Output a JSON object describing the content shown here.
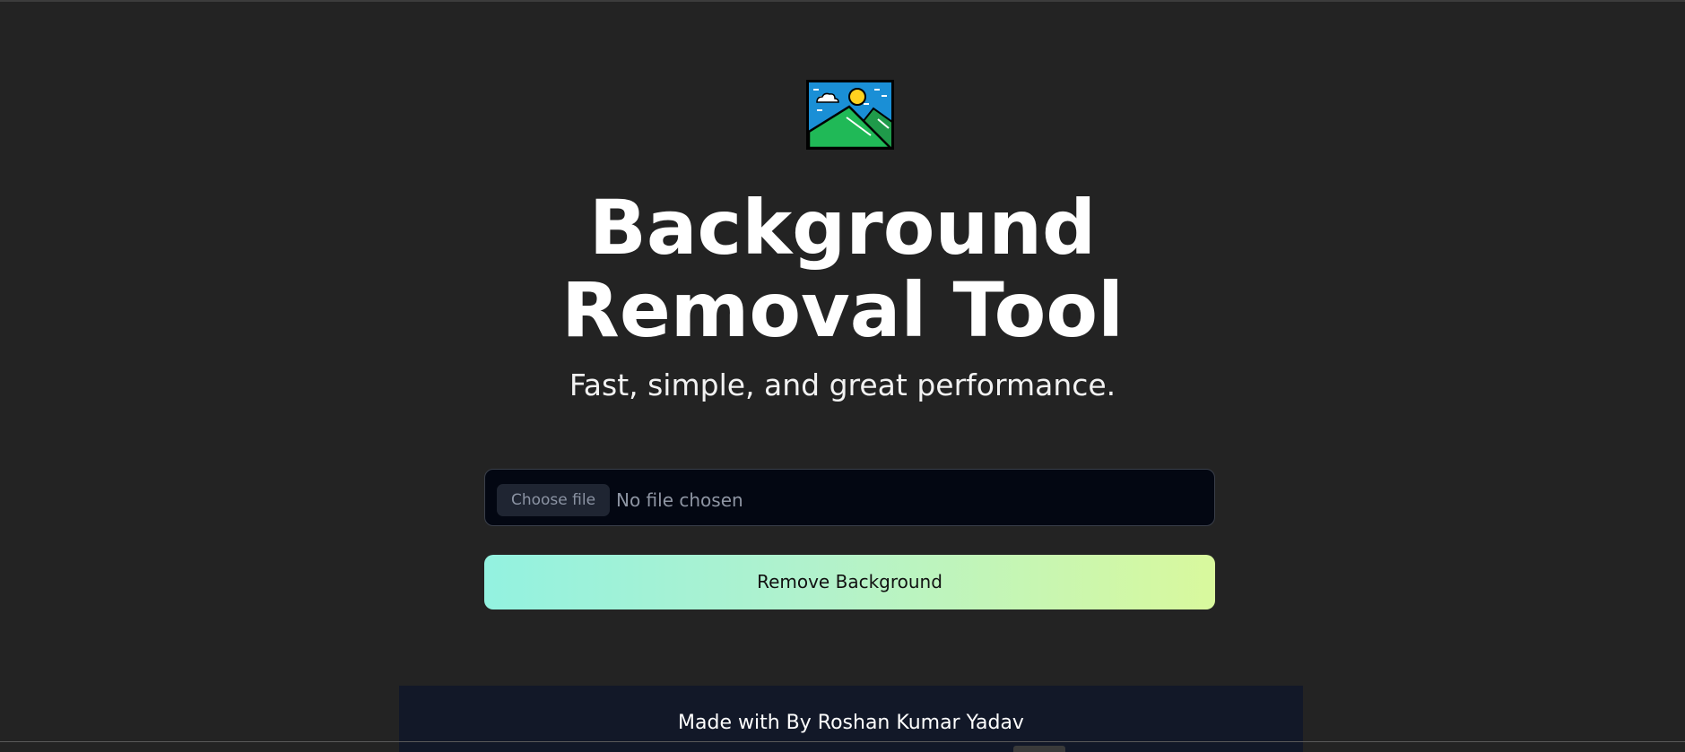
{
  "logo": {
    "icon": "landscape-picture-icon"
  },
  "title": "Background Removal Tool",
  "subtitle": "Fast, simple, and great performance.",
  "upload": {
    "choose_label": "Choose file",
    "status": "No file chosen"
  },
  "action": {
    "remove_label": "Remove Background"
  },
  "footer": {
    "text": "Made with By Roshan Kumar Yadav"
  },
  "colors": {
    "background": "#232323",
    "input_bg": "#030712",
    "gradient_start": "#93f2e0",
    "gradient_end": "#d9f99d",
    "footer_bg": "#121828"
  }
}
